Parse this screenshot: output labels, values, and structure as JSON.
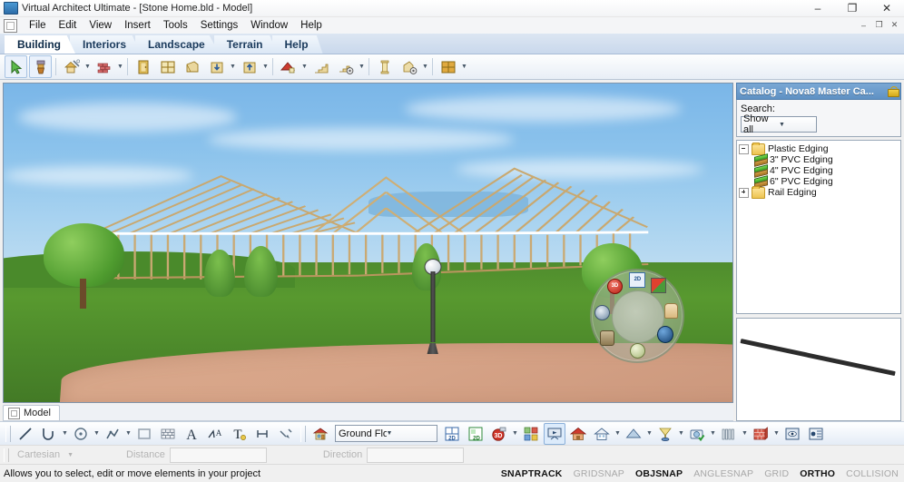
{
  "window": {
    "title": "Virtual Architect Ultimate - [Stone Home.bld - Model]",
    "app_icon": "app-icon",
    "minimize": "–",
    "maximize": "❐",
    "close": "✕",
    "mdi_minimize": "–",
    "mdi_restore": "❐",
    "mdi_close": "✕"
  },
  "menu": {
    "items": [
      {
        "label": "File"
      },
      {
        "label": "Edit"
      },
      {
        "label": "View"
      },
      {
        "label": "Insert"
      },
      {
        "label": "Tools"
      },
      {
        "label": "Settings"
      },
      {
        "label": "Window"
      },
      {
        "label": "Help"
      }
    ]
  },
  "ribbon_tabs": [
    {
      "label": "Building",
      "active": true
    },
    {
      "label": "Interiors",
      "active": false
    },
    {
      "label": "Landscape",
      "active": false
    },
    {
      "label": "Terrain",
      "active": false
    },
    {
      "label": "Help",
      "active": false
    }
  ],
  "main_toolbar": {
    "buttons": [
      {
        "name": "select-tool",
        "icon": "arrow-cursor-icon",
        "selected": true,
        "dropdown": false
      },
      {
        "name": "paint-tool",
        "icon": "paintbrush-icon",
        "selected": true,
        "dropdown": false
      },
      {
        "name": "house-wizard-tool",
        "icon": "house-magic-icon",
        "selected": false,
        "dropdown": true
      },
      {
        "name": "wall-tool",
        "icon": "wall-icon",
        "selected": false,
        "dropdown": true
      },
      {
        "name": "door-tool",
        "icon": "door-icon",
        "selected": false,
        "dropdown": false
      },
      {
        "name": "window-tool",
        "icon": "window-icon",
        "selected": false,
        "dropdown": false
      },
      {
        "name": "opening-tool",
        "icon": "opening-icon",
        "selected": false,
        "dropdown": false
      },
      {
        "name": "insert-object-tool",
        "icon": "box-down-arrow-icon",
        "selected": false,
        "dropdown": true
      },
      {
        "name": "place-object-tool",
        "icon": "box-up-arrow-icon",
        "selected": false,
        "dropdown": true
      },
      {
        "name": "roof-tool",
        "icon": "roof-icon",
        "selected": false,
        "dropdown": true
      },
      {
        "name": "stairs-tool",
        "icon": "stairs-icon",
        "selected": false,
        "dropdown": false
      },
      {
        "name": "stairs-settings-tool",
        "icon": "stairs-gear-icon",
        "selected": false,
        "dropdown": true
      },
      {
        "name": "column-tool",
        "icon": "column-icon",
        "selected": false,
        "dropdown": false
      },
      {
        "name": "fireplace-tool",
        "icon": "fireplace-gear-icon",
        "selected": false,
        "dropdown": true
      },
      {
        "name": "framing-tool",
        "icon": "framing-grid-icon",
        "selected": false,
        "dropdown": true
      }
    ]
  },
  "viewport": {
    "model_tab_label": "Model",
    "model_tab_icon": "cube-icon",
    "nav_widget": {
      "name": "navigation-compass-widget",
      "icons": [
        {
          "name": "view-3d-icon",
          "glyph": "3D"
        },
        {
          "name": "view-2d-icon",
          "glyph": "2D"
        },
        {
          "name": "color-palette-icon",
          "glyph": ""
        },
        {
          "name": "hand-pan-icon",
          "glyph": ""
        },
        {
          "name": "camera-orbit-icon",
          "glyph": ""
        },
        {
          "name": "walk-mode-icon",
          "glyph": ""
        },
        {
          "name": "zoom-target-icon",
          "glyph": ""
        },
        {
          "name": "compass-icon",
          "glyph": ""
        }
      ]
    }
  },
  "catalog": {
    "header_title": "Catalog - Nova8 Master Ca...",
    "lock_icon": "lock-icon",
    "search_label": "Search:",
    "filter_selected": "Show all",
    "filter_options": [
      "Show all"
    ],
    "tree": [
      {
        "label": "Plastic Edging",
        "type": "folder",
        "expanded": true,
        "depth": 0
      },
      {
        "label": "3\" PVC Edging",
        "type": "item",
        "depth": 1
      },
      {
        "label": "4\" PVC Edging",
        "type": "item",
        "depth": 1
      },
      {
        "label": "6\" PVC Edging",
        "type": "item",
        "depth": 1
      },
      {
        "label": "Rail Edging",
        "type": "folder",
        "expanded": false,
        "depth": 0
      }
    ],
    "preview_name": "catalog-item-preview"
  },
  "bottom_toolbar": {
    "draw_buttons": [
      {
        "name": "line-tool",
        "icon": "line-icon",
        "dropdown": false
      },
      {
        "name": "arc-tool",
        "icon": "arc-icon",
        "dropdown": true
      },
      {
        "name": "circle-tool",
        "icon": "circle-icon",
        "dropdown": true
      },
      {
        "name": "polyline-tool",
        "icon": "polyline-icon",
        "dropdown": true
      },
      {
        "name": "rectangle-tool",
        "icon": "rectangle-icon",
        "dropdown": false
      },
      {
        "name": "hatch-fill-tool",
        "icon": "brick-hatch-icon",
        "dropdown": false
      },
      {
        "name": "text-tool",
        "icon": "text-a-icon",
        "dropdown": false
      },
      {
        "name": "text-style-tool",
        "icon": "text-style-icon",
        "dropdown": false
      },
      {
        "name": "text-edit-tool",
        "icon": "text-edit-icon",
        "dropdown": false
      },
      {
        "name": "dimension-tool",
        "icon": "dimension-icon",
        "dropdown": false
      },
      {
        "name": "leader-tool",
        "icon": "leader-line-icon",
        "dropdown": false
      }
    ],
    "floor_icon": "house-floor-icon",
    "floor_selected": "Ground Floor",
    "floor_options": [
      "Ground Floor"
    ],
    "view_buttons": [
      {
        "name": "plan-view-2d-button",
        "icon": "plan-2d-icon",
        "dropdown": false
      },
      {
        "name": "elevation-2d-button",
        "icon": "elevation-2d-icon",
        "dropdown": false
      },
      {
        "name": "view-3d-button",
        "icon": "camera-3d-icon",
        "dropdown": true
      },
      {
        "name": "layers-button",
        "icon": "layers-icon",
        "dropdown": false
      },
      {
        "name": "presentation-button",
        "icon": "presentation-icon",
        "selected": true,
        "dropdown": false
      },
      {
        "name": "exterior-render-button",
        "icon": "red-house-icon",
        "dropdown": false
      },
      {
        "name": "interior-view-button",
        "icon": "white-house-icon",
        "dropdown": true
      },
      {
        "name": "roof-view-button",
        "icon": "roof-shade-icon",
        "dropdown": true
      },
      {
        "name": "sun-study-button",
        "icon": "sun-lamp-icon",
        "dropdown": true
      },
      {
        "name": "snapshot-button",
        "icon": "camera-check-icon",
        "dropdown": true
      },
      {
        "name": "fence-button",
        "icon": "fence-icon",
        "dropdown": true
      },
      {
        "name": "material-button",
        "icon": "brick-wall-icon",
        "dropdown": true
      },
      {
        "name": "preview-window-button",
        "icon": "eye-window-icon",
        "dropdown": false
      },
      {
        "name": "report-button",
        "icon": "report-icon",
        "dropdown": false
      }
    ]
  },
  "coordinate_bar": {
    "mode_label": "Cartesian",
    "distance_label": "Distance",
    "distance_value": "",
    "direction_label": "Direction",
    "direction_value": ""
  },
  "status_bar": {
    "message": "Allows you to select, edit or move elements in your project",
    "toggles": [
      {
        "label": "SNAPTRACK",
        "enabled": true
      },
      {
        "label": "GRIDSNAP",
        "enabled": false
      },
      {
        "label": "OBJSNAP",
        "enabled": true
      },
      {
        "label": "ANGLESNAP",
        "enabled": false
      },
      {
        "label": "GRID",
        "enabled": false
      },
      {
        "label": "ORTHO",
        "enabled": true
      },
      {
        "label": "COLLISION",
        "enabled": false
      }
    ]
  }
}
